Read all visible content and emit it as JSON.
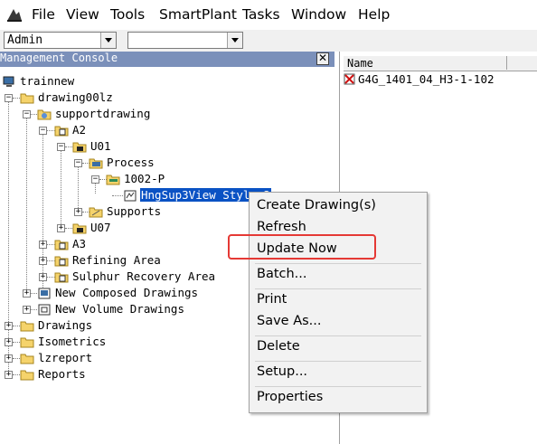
{
  "menubar": {
    "items": [
      "File",
      "View",
      "Tools",
      "SmartPlant",
      "Tasks",
      "Window",
      "Help"
    ]
  },
  "toolbar": {
    "combo1_value": "Admin",
    "combo2_value": ""
  },
  "left_pane": {
    "title": "Management Console",
    "close_glyph": "✕"
  },
  "tree": {
    "root": "trainnew",
    "drawing": "drawing00lz",
    "supportdrawing": "supportdrawing",
    "a2": "A2",
    "u01": "U01",
    "process": "Process",
    "p1002": "1002-P",
    "selected_view": "HngSup3View Style 2",
    "supports": "Supports",
    "u07": "U07",
    "a3": "A3",
    "refining": "Refining Area",
    "sulphur": "Sulphur Recovery Area",
    "composed": "New Composed Drawings",
    "volume": "New Volume Drawings",
    "drawings": "Drawings",
    "isometrics": "Isometrics",
    "lzreport": "lzreport",
    "reports": "Reports"
  },
  "right_pane": {
    "column_header": "Name",
    "item": "G4G_1401_04_H3-1-102"
  },
  "context_menu": {
    "items": [
      "Create Drawing(s)",
      "Refresh",
      "Update Now",
      "Batch...",
      "Print",
      "Save As...",
      "Delete",
      "Setup...",
      "Properties"
    ]
  },
  "colors": {
    "highlight_box": "#e53935",
    "selection": "#0a52c4",
    "pane_title": "#7b90ba"
  }
}
